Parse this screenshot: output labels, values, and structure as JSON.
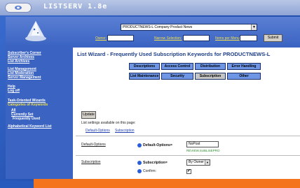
{
  "window": {
    "title": "LISTSERV 1.8e"
  },
  "top": {
    "list_selected": "PRODUCTNEWS-L Company Product News",
    "owner_label": "Owner:",
    "narrow_label": "Narrow Selection:",
    "items_label": "Items per Menu:",
    "submit_label": "Submit"
  },
  "sidebar": {
    "group1": [
      "Subscriber's Corner",
      "Server Archives",
      "List Archives"
    ],
    "group2": [
      "List Management",
      "List Moderation",
      "Server Management"
    ],
    "group3": [
      "Help",
      "Log off"
    ],
    "task_wizards": "Task-Oriented Wizards",
    "categories": "Categories of Keywords",
    "all": "All",
    "currently_set": "Currently Set",
    "frequently_used": "Frequently Used",
    "alphabetical": "Alphabetical Keyword List"
  },
  "main": {
    "title": "List Wizard - Frequently Used Subscription Keywords for PRODUCTNEWS-L",
    "tabs_row1": [
      "Descriptions",
      "Access Control",
      "Distribution",
      "Error Handling"
    ],
    "tabs_row2": [
      "List Maintenance",
      "Security",
      "Subscription",
      "Other"
    ],
    "selected_tab": "Subscription",
    "update_label": "Update",
    "settings_text": "List settings available on this page:",
    "anchor_links": [
      "Default-Options",
      "Subscription"
    ],
    "section1": {
      "link": "Default-Options",
      "label": "Default-Options=",
      "value": "NoPost",
      "hint": "REVIEW,SUBLISEPRO"
    },
    "section2": {
      "link": "Subscription",
      "label": "Subscription=",
      "value": "By Owner",
      "confirm_label": "Confirm:",
      "confirm_mark": "✔"
    }
  },
  "colors": {
    "accent": "#3a63c2",
    "orange": "#f4741e",
    "title": "#1e3f8a"
  }
}
